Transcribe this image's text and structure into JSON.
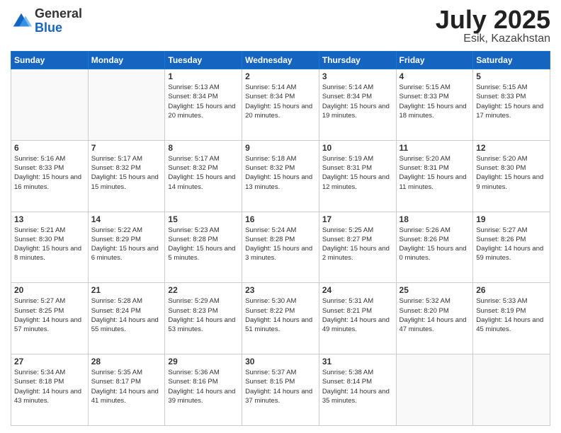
{
  "logo": {
    "general": "General",
    "blue": "Blue"
  },
  "title": "July 2025",
  "subtitle": "Esik, Kazakhstan",
  "days_header": [
    "Sunday",
    "Monday",
    "Tuesday",
    "Wednesday",
    "Thursday",
    "Friday",
    "Saturday"
  ],
  "weeks": [
    [
      {
        "day": "",
        "sunrise": "",
        "sunset": "",
        "daylight": ""
      },
      {
        "day": "",
        "sunrise": "",
        "sunset": "",
        "daylight": ""
      },
      {
        "day": "1",
        "sunrise": "Sunrise: 5:13 AM",
        "sunset": "Sunset: 8:34 PM",
        "daylight": "Daylight: 15 hours and 20 minutes."
      },
      {
        "day": "2",
        "sunrise": "Sunrise: 5:14 AM",
        "sunset": "Sunset: 8:34 PM",
        "daylight": "Daylight: 15 hours and 20 minutes."
      },
      {
        "day": "3",
        "sunrise": "Sunrise: 5:14 AM",
        "sunset": "Sunset: 8:34 PM",
        "daylight": "Daylight: 15 hours and 19 minutes."
      },
      {
        "day": "4",
        "sunrise": "Sunrise: 5:15 AM",
        "sunset": "Sunset: 8:33 PM",
        "daylight": "Daylight: 15 hours and 18 minutes."
      },
      {
        "day": "5",
        "sunrise": "Sunrise: 5:15 AM",
        "sunset": "Sunset: 8:33 PM",
        "daylight": "Daylight: 15 hours and 17 minutes."
      }
    ],
    [
      {
        "day": "6",
        "sunrise": "Sunrise: 5:16 AM",
        "sunset": "Sunset: 8:33 PM",
        "daylight": "Daylight: 15 hours and 16 minutes."
      },
      {
        "day": "7",
        "sunrise": "Sunrise: 5:17 AM",
        "sunset": "Sunset: 8:32 PM",
        "daylight": "Daylight: 15 hours and 15 minutes."
      },
      {
        "day": "8",
        "sunrise": "Sunrise: 5:17 AM",
        "sunset": "Sunset: 8:32 PM",
        "daylight": "Daylight: 15 hours and 14 minutes."
      },
      {
        "day": "9",
        "sunrise": "Sunrise: 5:18 AM",
        "sunset": "Sunset: 8:32 PM",
        "daylight": "Daylight: 15 hours and 13 minutes."
      },
      {
        "day": "10",
        "sunrise": "Sunrise: 5:19 AM",
        "sunset": "Sunset: 8:31 PM",
        "daylight": "Daylight: 15 hours and 12 minutes."
      },
      {
        "day": "11",
        "sunrise": "Sunrise: 5:20 AM",
        "sunset": "Sunset: 8:31 PM",
        "daylight": "Daylight: 15 hours and 11 minutes."
      },
      {
        "day": "12",
        "sunrise": "Sunrise: 5:20 AM",
        "sunset": "Sunset: 8:30 PM",
        "daylight": "Daylight: 15 hours and 9 minutes."
      }
    ],
    [
      {
        "day": "13",
        "sunrise": "Sunrise: 5:21 AM",
        "sunset": "Sunset: 8:30 PM",
        "daylight": "Daylight: 15 hours and 8 minutes."
      },
      {
        "day": "14",
        "sunrise": "Sunrise: 5:22 AM",
        "sunset": "Sunset: 8:29 PM",
        "daylight": "Daylight: 15 hours and 6 minutes."
      },
      {
        "day": "15",
        "sunrise": "Sunrise: 5:23 AM",
        "sunset": "Sunset: 8:28 PM",
        "daylight": "Daylight: 15 hours and 5 minutes."
      },
      {
        "day": "16",
        "sunrise": "Sunrise: 5:24 AM",
        "sunset": "Sunset: 8:28 PM",
        "daylight": "Daylight: 15 hours and 3 minutes."
      },
      {
        "day": "17",
        "sunrise": "Sunrise: 5:25 AM",
        "sunset": "Sunset: 8:27 PM",
        "daylight": "Daylight: 15 hours and 2 minutes."
      },
      {
        "day": "18",
        "sunrise": "Sunrise: 5:26 AM",
        "sunset": "Sunset: 8:26 PM",
        "daylight": "Daylight: 15 hours and 0 minutes."
      },
      {
        "day": "19",
        "sunrise": "Sunrise: 5:27 AM",
        "sunset": "Sunset: 8:26 PM",
        "daylight": "Daylight: 14 hours and 59 minutes."
      }
    ],
    [
      {
        "day": "20",
        "sunrise": "Sunrise: 5:27 AM",
        "sunset": "Sunset: 8:25 PM",
        "daylight": "Daylight: 14 hours and 57 minutes."
      },
      {
        "day": "21",
        "sunrise": "Sunrise: 5:28 AM",
        "sunset": "Sunset: 8:24 PM",
        "daylight": "Daylight: 14 hours and 55 minutes."
      },
      {
        "day": "22",
        "sunrise": "Sunrise: 5:29 AM",
        "sunset": "Sunset: 8:23 PM",
        "daylight": "Daylight: 14 hours and 53 minutes."
      },
      {
        "day": "23",
        "sunrise": "Sunrise: 5:30 AM",
        "sunset": "Sunset: 8:22 PM",
        "daylight": "Daylight: 14 hours and 51 minutes."
      },
      {
        "day": "24",
        "sunrise": "Sunrise: 5:31 AM",
        "sunset": "Sunset: 8:21 PM",
        "daylight": "Daylight: 14 hours and 49 minutes."
      },
      {
        "day": "25",
        "sunrise": "Sunrise: 5:32 AM",
        "sunset": "Sunset: 8:20 PM",
        "daylight": "Daylight: 14 hours and 47 minutes."
      },
      {
        "day": "26",
        "sunrise": "Sunrise: 5:33 AM",
        "sunset": "Sunset: 8:19 PM",
        "daylight": "Daylight: 14 hours and 45 minutes."
      }
    ],
    [
      {
        "day": "27",
        "sunrise": "Sunrise: 5:34 AM",
        "sunset": "Sunset: 8:18 PM",
        "daylight": "Daylight: 14 hours and 43 minutes."
      },
      {
        "day": "28",
        "sunrise": "Sunrise: 5:35 AM",
        "sunset": "Sunset: 8:17 PM",
        "daylight": "Daylight: 14 hours and 41 minutes."
      },
      {
        "day": "29",
        "sunrise": "Sunrise: 5:36 AM",
        "sunset": "Sunset: 8:16 PM",
        "daylight": "Daylight: 14 hours and 39 minutes."
      },
      {
        "day": "30",
        "sunrise": "Sunrise: 5:37 AM",
        "sunset": "Sunset: 8:15 PM",
        "daylight": "Daylight: 14 hours and 37 minutes."
      },
      {
        "day": "31",
        "sunrise": "Sunrise: 5:38 AM",
        "sunset": "Sunset: 8:14 PM",
        "daylight": "Daylight: 14 hours and 35 minutes."
      },
      {
        "day": "",
        "sunrise": "",
        "sunset": "",
        "daylight": ""
      },
      {
        "day": "",
        "sunrise": "",
        "sunset": "",
        "daylight": ""
      }
    ]
  ]
}
